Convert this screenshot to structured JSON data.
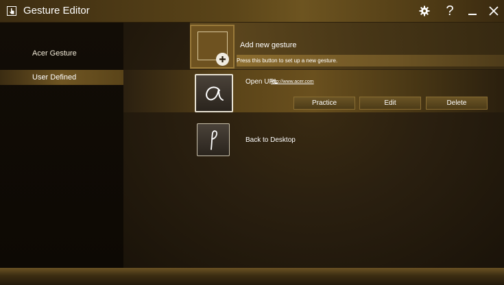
{
  "window": {
    "title": "Gesture Editor"
  },
  "titlebar": {
    "icons": [
      "hand-pointer-icon",
      "gear-icon",
      "help-icon",
      "minimize-icon",
      "close-icon"
    ],
    "help_glyph": "?"
  },
  "sidebar": {
    "items": [
      {
        "label": "Acer Gesture",
        "selected": false
      },
      {
        "label": "User Defined",
        "selected": true
      }
    ]
  },
  "main": {
    "add_gesture": {
      "title": "Add new gesture",
      "subtitle": "Press this button to set up a new gesture."
    },
    "gestures": [
      {
        "name": "Open URL",
        "url": "http://www.acer.com",
        "glyph": "a",
        "selected": true,
        "actions": [
          "Practice",
          "Edit",
          "Delete"
        ]
      },
      {
        "name": "Back to Desktop",
        "glyph": "P",
        "selected": false
      }
    ]
  },
  "colors": {
    "accent": "#6a501e",
    "text": "#ffffff",
    "background": "#0f0b05"
  }
}
